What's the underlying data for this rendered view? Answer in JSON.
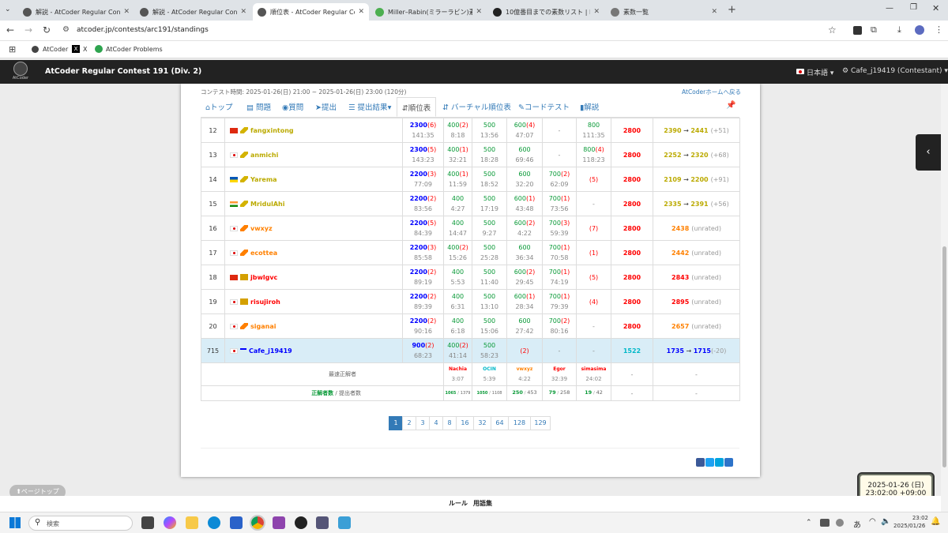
{
  "browser": {
    "tabs": [
      {
        "label": "解説 - AtCoder Regular Contes",
        "active": false,
        "color": "#555"
      },
      {
        "label": "解説 - AtCoder Regular Contes",
        "active": false,
        "color": "#555"
      },
      {
        "label": "順位表 - AtCoder Regular Contes",
        "active": true,
        "color": "#555"
      },
      {
        "label": "Miller–Rabin(ミラーラビン)素数判定",
        "active": false,
        "color": "#4caf50"
      },
      {
        "label": "10億番目までの素数リスト | Pytho",
        "active": false,
        "color": "#222"
      },
      {
        "label": "素数一覧",
        "active": false,
        "color": "#777"
      }
    ],
    "url": "atcoder.jp/contests/arc191/standings",
    "bookmarks": [
      "AtCoder",
      "X",
      "AtCoder Problems"
    ]
  },
  "site": {
    "title": "AtCoder Regular Contest 191 (Div. 2)",
    "logo_text": "AtCoder",
    "lang": "日本語",
    "user": "Cafe_j19419 (Contestant)"
  },
  "contest": {
    "time": "コンテスト時間: 2025-01-26(日) 21:00 ~ 2025-01-26(日) 23:00 (120分)",
    "home_link": "AtCoderホームへ戻る",
    "nav": [
      "トップ",
      "問題",
      "質問",
      "提出",
      "提出結果",
      "順位表",
      "バーチャル順位表",
      "コードテスト",
      "解説"
    ]
  },
  "rows": [
    {
      "rank": "12",
      "flag": "cn",
      "crown": "y",
      "name": "fangxintong",
      "namecolor": "#bbaa00",
      "score": "2300",
      "pen": "(6)",
      "time": "141:35",
      "cells": [
        [
          "400",
          "(2)",
          "8:18"
        ],
        [
          "500",
          "",
          "13:56"
        ],
        [
          "600",
          "(4)",
          "47:07"
        ],
        [
          "-",
          "",
          ""
        ],
        [
          "800",
          "",
          "111:35"
        ]
      ],
      "points": "2800",
      "rating": "2390",
      "after": "2441",
      "diff": "(+51)",
      "rc": "#bbaa00",
      "ac": "#bbaa00"
    },
    {
      "rank": "13",
      "flag": "jp",
      "crown": "y",
      "name": "anmichi",
      "namecolor": "#bbaa00",
      "score": "2300",
      "pen": "(5)",
      "time": "143:23",
      "cells": [
        [
          "400",
          "(1)",
          "32:21"
        ],
        [
          "500",
          "",
          "18:28"
        ],
        [
          "600",
          "",
          "69:46"
        ],
        [
          "-",
          "",
          ""
        ],
        [
          "800",
          "(4)",
          "118:23"
        ]
      ],
      "points": "2800",
      "rating": "2252",
      "after": "2320",
      "diff": "(+68)",
      "rc": "#bbaa00",
      "ac": "#bbaa00"
    },
    {
      "rank": "14",
      "flag": "ua",
      "crown": "y",
      "name": "Yarema",
      "namecolor": "#bbaa00",
      "score": "2200",
      "pen": "(3)",
      "time": "77:09",
      "cells": [
        [
          "400",
          "(1)",
          "11:59"
        ],
        [
          "500",
          "",
          "18:52"
        ],
        [
          "600",
          "",
          "32:20"
        ],
        [
          "700",
          "(2)",
          "62:09"
        ],
        [
          "",
          "(5)",
          ""
        ]
      ],
      "points": "2800",
      "rating": "2109",
      "after": "2200",
      "diff": "(+91)",
      "rc": "#bbaa00",
      "ac": "#bbaa00"
    },
    {
      "rank": "15",
      "flag": "in",
      "crown": "y",
      "name": "MridulAhi",
      "namecolor": "#bbaa00",
      "score": "2200",
      "pen": "(2)",
      "time": "83:56",
      "cells": [
        [
          "400",
          "",
          "4:27"
        ],
        [
          "500",
          "",
          "17:19"
        ],
        [
          "600",
          "(1)",
          "43:48"
        ],
        [
          "700",
          "(1)",
          "73:56"
        ],
        [
          "-",
          "",
          ""
        ]
      ],
      "points": "2800",
      "rating": "2335",
      "after": "2391",
      "diff": "(+56)",
      "rc": "#bbaa00",
      "ac": "#bbaa00"
    },
    {
      "rank": "16",
      "flag": "jp",
      "crown": "o",
      "name": "vwxyz",
      "namecolor": "#ff8000",
      "score": "2200",
      "pen": "(5)",
      "time": "84:39",
      "cells": [
        [
          "400",
          "",
          "14:47"
        ],
        [
          "500",
          "",
          "9:27"
        ],
        [
          "600",
          "(2)",
          "4:22"
        ],
        [
          "700",
          "(3)",
          "59:39"
        ],
        [
          "",
          "(7)",
          ""
        ]
      ],
      "points": "2800",
      "rating": "2438",
      "after": "",
      "diff": "(unrated)",
      "rc": "#ff8000",
      "ac": ""
    },
    {
      "rank": "17",
      "flag": "jp",
      "crown": "o",
      "name": "ecottea",
      "namecolor": "#ff8000",
      "score": "2200",
      "pen": "(3)",
      "time": "85:58",
      "cells": [
        [
          "400",
          "(2)",
          "15:26"
        ],
        [
          "500",
          "",
          "25:28"
        ],
        [
          "600",
          "",
          "36:34"
        ],
        [
          "700",
          "(1)",
          "70:58"
        ],
        [
          "",
          "(1)",
          ""
        ]
      ],
      "points": "2800",
      "rating": "2442",
      "after": "",
      "diff": "(unrated)",
      "rc": "#ff8000",
      "ac": ""
    },
    {
      "rank": "18",
      "flag": "cn",
      "crown": "r",
      "name": "jbwlgvc",
      "namecolor": "#ff0000",
      "score": "2200",
      "pen": "(2)",
      "time": "89:19",
      "cells": [
        [
          "400",
          "",
          "5:53"
        ],
        [
          "500",
          "",
          "11:40"
        ],
        [
          "600",
          "(2)",
          "29:45"
        ],
        [
          "700",
          "(1)",
          "74:19"
        ],
        [
          "",
          "(5)",
          ""
        ]
      ],
      "points": "2800",
      "rating": "2843",
      "after": "",
      "diff": "(unrated)",
      "rc": "#ff0000",
      "ac": ""
    },
    {
      "rank": "19",
      "flag": "jp",
      "crown": "r",
      "name": "risujiroh",
      "namecolor": "#ff0000",
      "score": "2200",
      "pen": "(2)",
      "time": "89:39",
      "cells": [
        [
          "400",
          "",
          "6:31"
        ],
        [
          "500",
          "",
          "13:10"
        ],
        [
          "600",
          "(1)",
          "28:34"
        ],
        [
          "700",
          "(1)",
          "79:39"
        ],
        [
          "",
          "(4)",
          ""
        ]
      ],
      "points": "2800",
      "rating": "2895",
      "after": "",
      "diff": "(unrated)",
      "rc": "#ff0000",
      "ac": ""
    },
    {
      "rank": "20",
      "flag": "jp",
      "crown": "o",
      "name": "siganai",
      "namecolor": "#ff8000",
      "score": "2200",
      "pen": "(2)",
      "time": "90:16",
      "cells": [
        [
          "400",
          "",
          "6:18"
        ],
        [
          "500",
          "",
          "15:06"
        ],
        [
          "600",
          "",
          "27:42"
        ],
        [
          "700",
          "(2)",
          "80:16"
        ],
        [
          "-",
          "",
          ""
        ]
      ],
      "points": "2800",
      "rating": "2657",
      "after": "",
      "diff": "(unrated)",
      "rc": "#ff8000",
      "ac": ""
    }
  ],
  "me": {
    "rank": "715",
    "name": "Cafe_j19419",
    "score": "900",
    "pen": "(2)",
    "time": "68:23",
    "cells": [
      [
        "400",
        "(2)",
        "41:14"
      ],
      [
        "500",
        "",
        "58:23"
      ],
      [
        "",
        "(2)",
        ""
      ],
      [
        "-",
        "",
        ""
      ],
      [
        "-",
        "",
        ""
      ]
    ],
    "points": "1522",
    "rating": "1735",
    "after": "1715",
    "diff": "(-20)"
  },
  "first_ac": {
    "label": "最速正解者",
    "names": [
      "Nachia",
      "OCIN",
      "vwxyz",
      "Egor",
      "simasima"
    ],
    "times": [
      "3:07",
      "5:39",
      "4:22",
      "32:39",
      "24:02"
    ],
    "dash1": "-",
    "dash2": "-"
  },
  "stats": {
    "label_ac": "正解者数",
    "label_sub": " / 提出者数",
    "ac": [
      "1065",
      "1050",
      "250",
      "79",
      "19"
    ],
    "sub": [
      "1379",
      "1108",
      "453",
      "258",
      "42"
    ],
    "dash1": "-",
    "dash2": "-"
  },
  "pages": [
    "1",
    "2",
    "3",
    "4",
    "8",
    "16",
    "32",
    "64",
    "128",
    "129"
  ],
  "page_top": "ページトップ",
  "footer": [
    "ルール",
    "用語集"
  ],
  "clock": {
    "date": "2025-01-26 (日)",
    "time": "23:02:00 +09:00"
  },
  "taskbar": {
    "search": "検索",
    "ime": "あ",
    "time": "23:02",
    "date": "2025/01/26"
  }
}
